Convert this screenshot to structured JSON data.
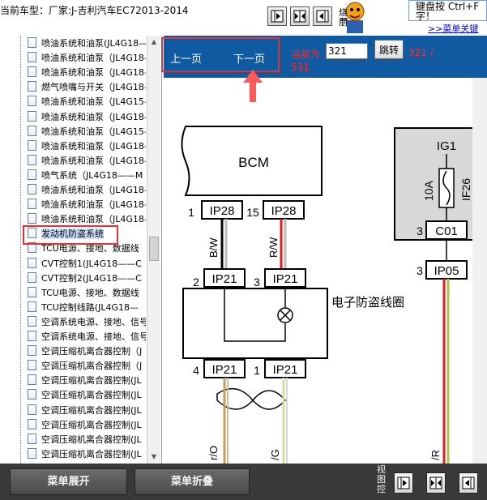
{
  "header": {
    "car_model": "当前车型：厂家:J-吉利汽车EC72013-2014",
    "mascot_text": "烧 朋",
    "hint_text": "键盘按 Ctrl+F 字！",
    "hint_link": ">>菜单关键"
  },
  "tree": {
    "items": [
      {
        "label": "喷油系统和油泵(JL4G18—"
      },
      {
        "label": "喷油系统和油泵（JL4G18—"
      },
      {
        "label": "喷油系统和油泵（JL4G18—"
      },
      {
        "label": "燃气喷嘴与开关（JL4G18—"
      },
      {
        "label": "喷油系统和油泵（JL4G15—"
      },
      {
        "label": "喷油系统和油泵（JL4G18—"
      },
      {
        "label": "喷油系统和油泵（JL4G15—"
      },
      {
        "label": "喷油系统和油泵（JL4G18—"
      },
      {
        "label": "喷油系统和油泵（JL4G18—"
      },
      {
        "label": "喷气系统（JL4G18——M"
      },
      {
        "label": "喷油系统和油泵（JL4G18—"
      },
      {
        "label": "喷油系统和油泵（JL4G18—"
      },
      {
        "label": "喷油系统和油泵（JL4G18—"
      },
      {
        "label": "发动机防盗系统",
        "selected": true
      },
      {
        "label": "TCU电源、接地、数据线"
      },
      {
        "label": "CVT控制1(JL4G18——C"
      },
      {
        "label": "CVT控制2(JL4G18——C"
      },
      {
        "label": "TCU电源、接地、数据线"
      },
      {
        "label": "TCU控制线路(JL4G18—"
      },
      {
        "label": "空调系统电源、接地、信号"
      },
      {
        "label": "空调系统电源、接地、信号"
      },
      {
        "label": "空调压缩机离合器控制（J"
      },
      {
        "label": "空调压缩机离合器控制（J"
      },
      {
        "label": "空调压缩机离合器控制(JL"
      },
      {
        "label": "空调压缩机离合器控制(JL"
      },
      {
        "label": "空调压缩机离合器控制(JL"
      },
      {
        "label": "空调压缩机离合器控制(JL"
      },
      {
        "label": "空调压缩机离合器控制(JL"
      },
      {
        "label": "空调压缩机离合器控制(JL"
      }
    ]
  },
  "pager": {
    "prev_label": "上一页",
    "next_label": "下一页",
    "current_label": "当前为",
    "page_value": "321",
    "jump_label": "跳转",
    "total_a": "321 /",
    "total_b": "531"
  },
  "diagram": {
    "bcm_label": "BCM",
    "pin_1": "1",
    "ip28_a": "IP28",
    "pin_15": "15",
    "ip28_b": "IP28",
    "wire_bw": "B/W",
    "wire_rw": "R/W",
    "pin_2": "2",
    "ip21_a": "IP21",
    "pin_3a": "3",
    "ip21_b": "IP21",
    "coil_label": "电子防盗线圈",
    "pin_4": "4",
    "ip21_c": "IP21",
    "pin_1b": "1",
    "ip21_d": "IP21",
    "wire_o": "r/O",
    "wire_g": "/G",
    "wire_r": "/R",
    "ig1": "IG1",
    "fuse_amp": "10A",
    "fuse_name": "IF26",
    "pin_3b": "3",
    "c01": "C01",
    "pin_3c": "3",
    "ip05": "IP05"
  },
  "footer": {
    "expand_label": "菜单展开",
    "collapse_label": "菜单折叠",
    "view_ctrl_label": "视图控"
  },
  "colors": {
    "viewer_bar": "#0f5aa0",
    "highlight": "#e23232",
    "page_text": "#ff2a2a",
    "bottom_bar": "#3a3a3a"
  },
  "icons": [
    "split-left-icon",
    "split-both-icon",
    "split-right-icon",
    "mascot-icon",
    "document-icon"
  ]
}
